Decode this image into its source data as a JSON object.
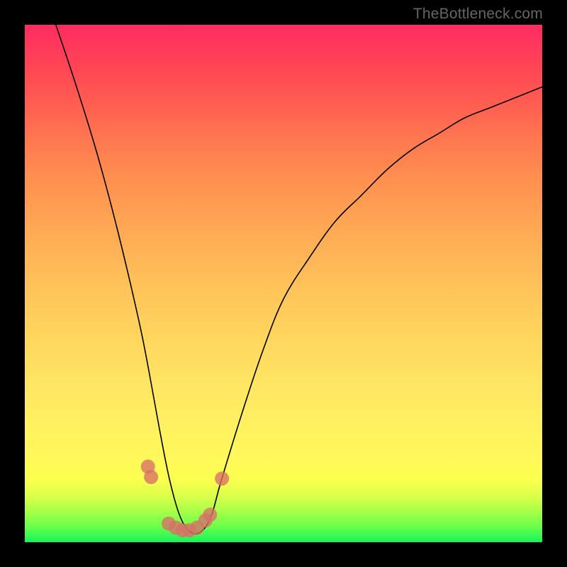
{
  "attribution": "TheBottleneck.com",
  "chart_data": {
    "type": "line",
    "title": "",
    "xlabel": "",
    "ylabel": "",
    "xlim": [
      0,
      100
    ],
    "ylim": [
      0,
      100
    ],
    "grid": false,
    "legend": false,
    "notes": "V-shaped bottleneck curve on vertical green-to-red gradient. No axis ticks or labels are visible.",
    "series": [
      {
        "name": "bottleneck-curve",
        "x": [
          6,
          10,
          14,
          18,
          22,
          24,
          26,
          28,
          30,
          32,
          34,
          36,
          38,
          42,
          46,
          50,
          55,
          60,
          65,
          70,
          75,
          80,
          85,
          90,
          95,
          100
        ],
        "y": [
          100,
          88,
          75,
          60,
          43,
          33,
          22,
          12,
          5,
          2,
          2,
          5,
          12,
          25,
          37,
          47,
          55,
          62,
          67,
          72,
          76,
          79,
          82,
          84,
          86,
          88
        ]
      }
    ],
    "points": [
      {
        "name": "left-dot-upper",
        "x": 23.8,
        "y": 14.6
      },
      {
        "name": "left-dot-mid",
        "x": 24.4,
        "y": 12.6
      },
      {
        "name": "trough-dot-1",
        "x": 27.8,
        "y": 3.6
      },
      {
        "name": "trough-dot-2",
        "x": 29.2,
        "y": 2.8
      },
      {
        "name": "trough-dot-3",
        "x": 30.5,
        "y": 2.3
      },
      {
        "name": "trough-dot-4",
        "x": 31.8,
        "y": 2.3
      },
      {
        "name": "trough-dot-5",
        "x": 33.3,
        "y": 2.8
      },
      {
        "name": "trough-dot-6",
        "x": 34.9,
        "y": 4.2
      },
      {
        "name": "trough-dot-7",
        "x": 35.8,
        "y": 5.3
      },
      {
        "name": "right-dot",
        "x": 38.1,
        "y": 12.3
      }
    ]
  }
}
